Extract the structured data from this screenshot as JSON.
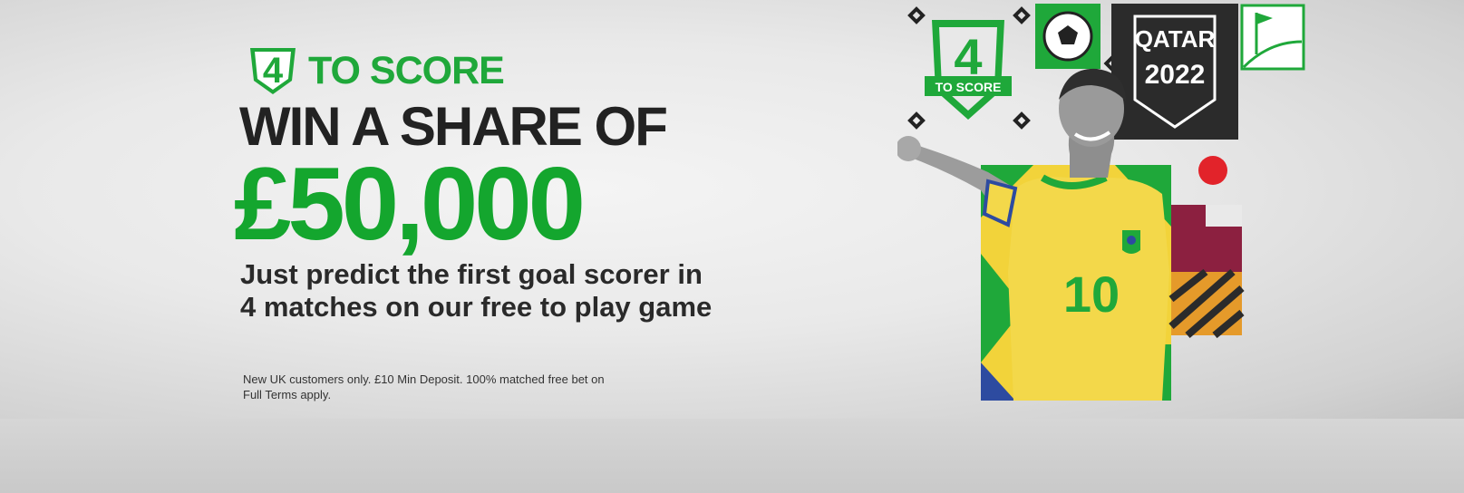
{
  "promo": {
    "logo_number": "4",
    "logo_text": "TO SCORE",
    "headline": "WIN A SHARE OF",
    "amount": "£50,000",
    "sub_line_1": "Just predict the first goal scorer in",
    "sub_line_2": "4 matches on our free to play game",
    "terms_line_1": "New UK customers only. £10 Min Deposit. 100% matched free bet on",
    "terms_line_2": "Full Terms apply."
  },
  "art": {
    "badge_number": "4",
    "badge_text": "TO SCORE",
    "event_line_1": "QATAR",
    "event_line_2": "2022",
    "shirt_number": "10"
  },
  "colors": {
    "brand_green": "#14a62e",
    "headline_dark": "#222222",
    "shirt_yellow": "#f2d33a",
    "accent_red": "#e2232a",
    "maroon": "#8c2040",
    "panel_dark": "#2b2b2b"
  },
  "icons": [
    "four-to-score-logo-icon",
    "football-icon",
    "corner-flag-icon",
    "diamond-icon"
  ]
}
